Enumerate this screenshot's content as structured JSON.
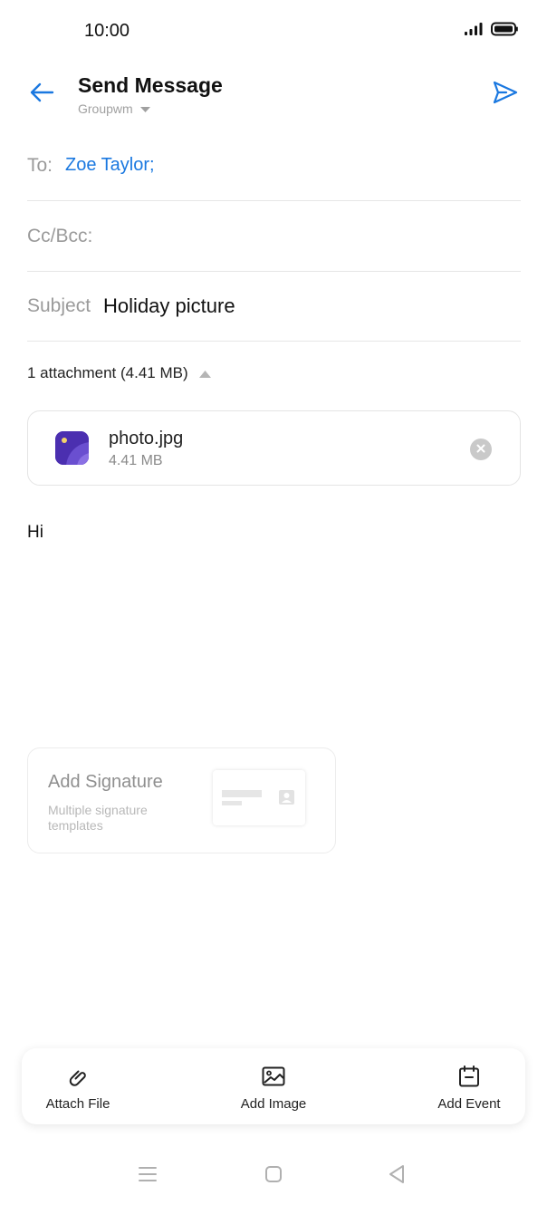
{
  "status_bar": {
    "time": "10:00",
    "icons": [
      "signal-icon",
      "battery-icon"
    ]
  },
  "header": {
    "title": "Send Message",
    "account": "Groupwm",
    "back_icon": "arrow-left-icon",
    "send_icon": "send-icon"
  },
  "fields": {
    "to_label": "To:",
    "to_value": "Zoe Taylor;",
    "cc_label": "Cc/Bcc:",
    "subject_label": "Subject",
    "subject_value": "Holiday picture"
  },
  "attachments": {
    "summary": "1 attachment (4.41 MB)",
    "items": [
      {
        "name": "photo.jpg",
        "size": "4.41 MB",
        "icon": "image-file-icon"
      }
    ]
  },
  "body": {
    "text": "Hi"
  },
  "signature": {
    "title": "Add Signature",
    "subtitle": "Multiple signature templates"
  },
  "toolbar": {
    "attach_file": "Attach File",
    "add_image": "Add Image",
    "add_event": "Add Event"
  },
  "nav": {
    "icons": [
      "menu-icon",
      "home-icon",
      "back-triangle-icon"
    ]
  },
  "colors": {
    "accent": "#1a78e0",
    "muted": "#9a9a9a",
    "file_icon": "#5a3fc0"
  }
}
